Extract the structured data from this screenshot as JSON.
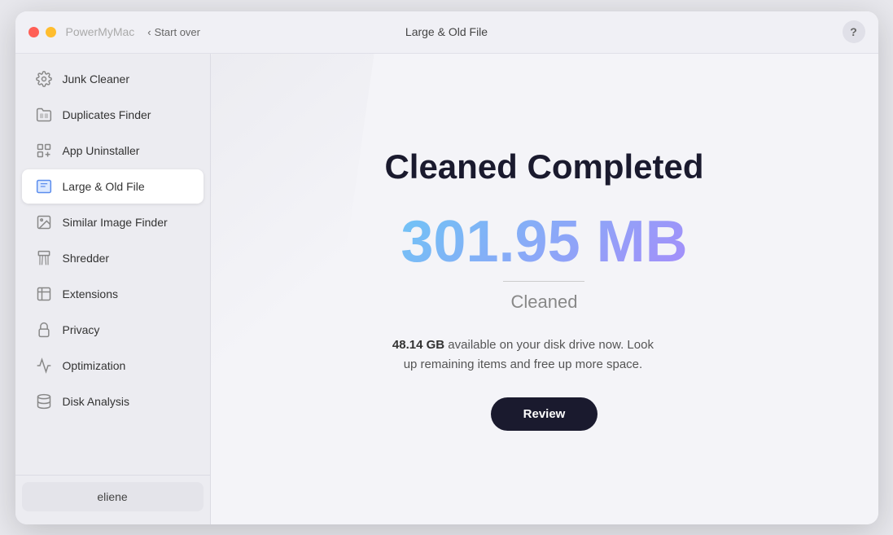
{
  "titleBar": {
    "appName": "PowerMyMac",
    "startOver": "Start over",
    "pageTitle": "Large & Old File",
    "helpLabel": "?"
  },
  "sidebar": {
    "items": [
      {
        "id": "junk-cleaner",
        "label": "Junk Cleaner",
        "icon": "gear-circle-icon",
        "active": false
      },
      {
        "id": "duplicates-finder",
        "label": "Duplicates Finder",
        "icon": "folder-icon",
        "active": false
      },
      {
        "id": "app-uninstaller",
        "label": "App Uninstaller",
        "icon": "app-icon",
        "active": false
      },
      {
        "id": "large-old-file",
        "label": "Large & Old File",
        "icon": "file-icon",
        "active": true
      },
      {
        "id": "similar-image-finder",
        "label": "Similar Image Finder",
        "icon": "image-icon",
        "active": false
      },
      {
        "id": "shredder",
        "label": "Shredder",
        "icon": "shredder-icon",
        "active": false
      },
      {
        "id": "extensions",
        "label": "Extensions",
        "icon": "extensions-icon",
        "active": false
      },
      {
        "id": "privacy",
        "label": "Privacy",
        "icon": "privacy-icon",
        "active": false
      },
      {
        "id": "optimization",
        "label": "Optimization",
        "icon": "optimization-icon",
        "active": false
      },
      {
        "id": "disk-analysis",
        "label": "Disk Analysis",
        "icon": "disk-icon",
        "active": false
      }
    ],
    "userButton": "eliene"
  },
  "content": {
    "title": "Cleaned Completed",
    "amount": "301.95 MB",
    "cleanedLabel": "Cleaned",
    "diskInfo": {
      "size": "48.14 GB",
      "description": " available on your disk drive now. Look up remaining items and free up more space."
    },
    "reviewButton": "Review"
  }
}
